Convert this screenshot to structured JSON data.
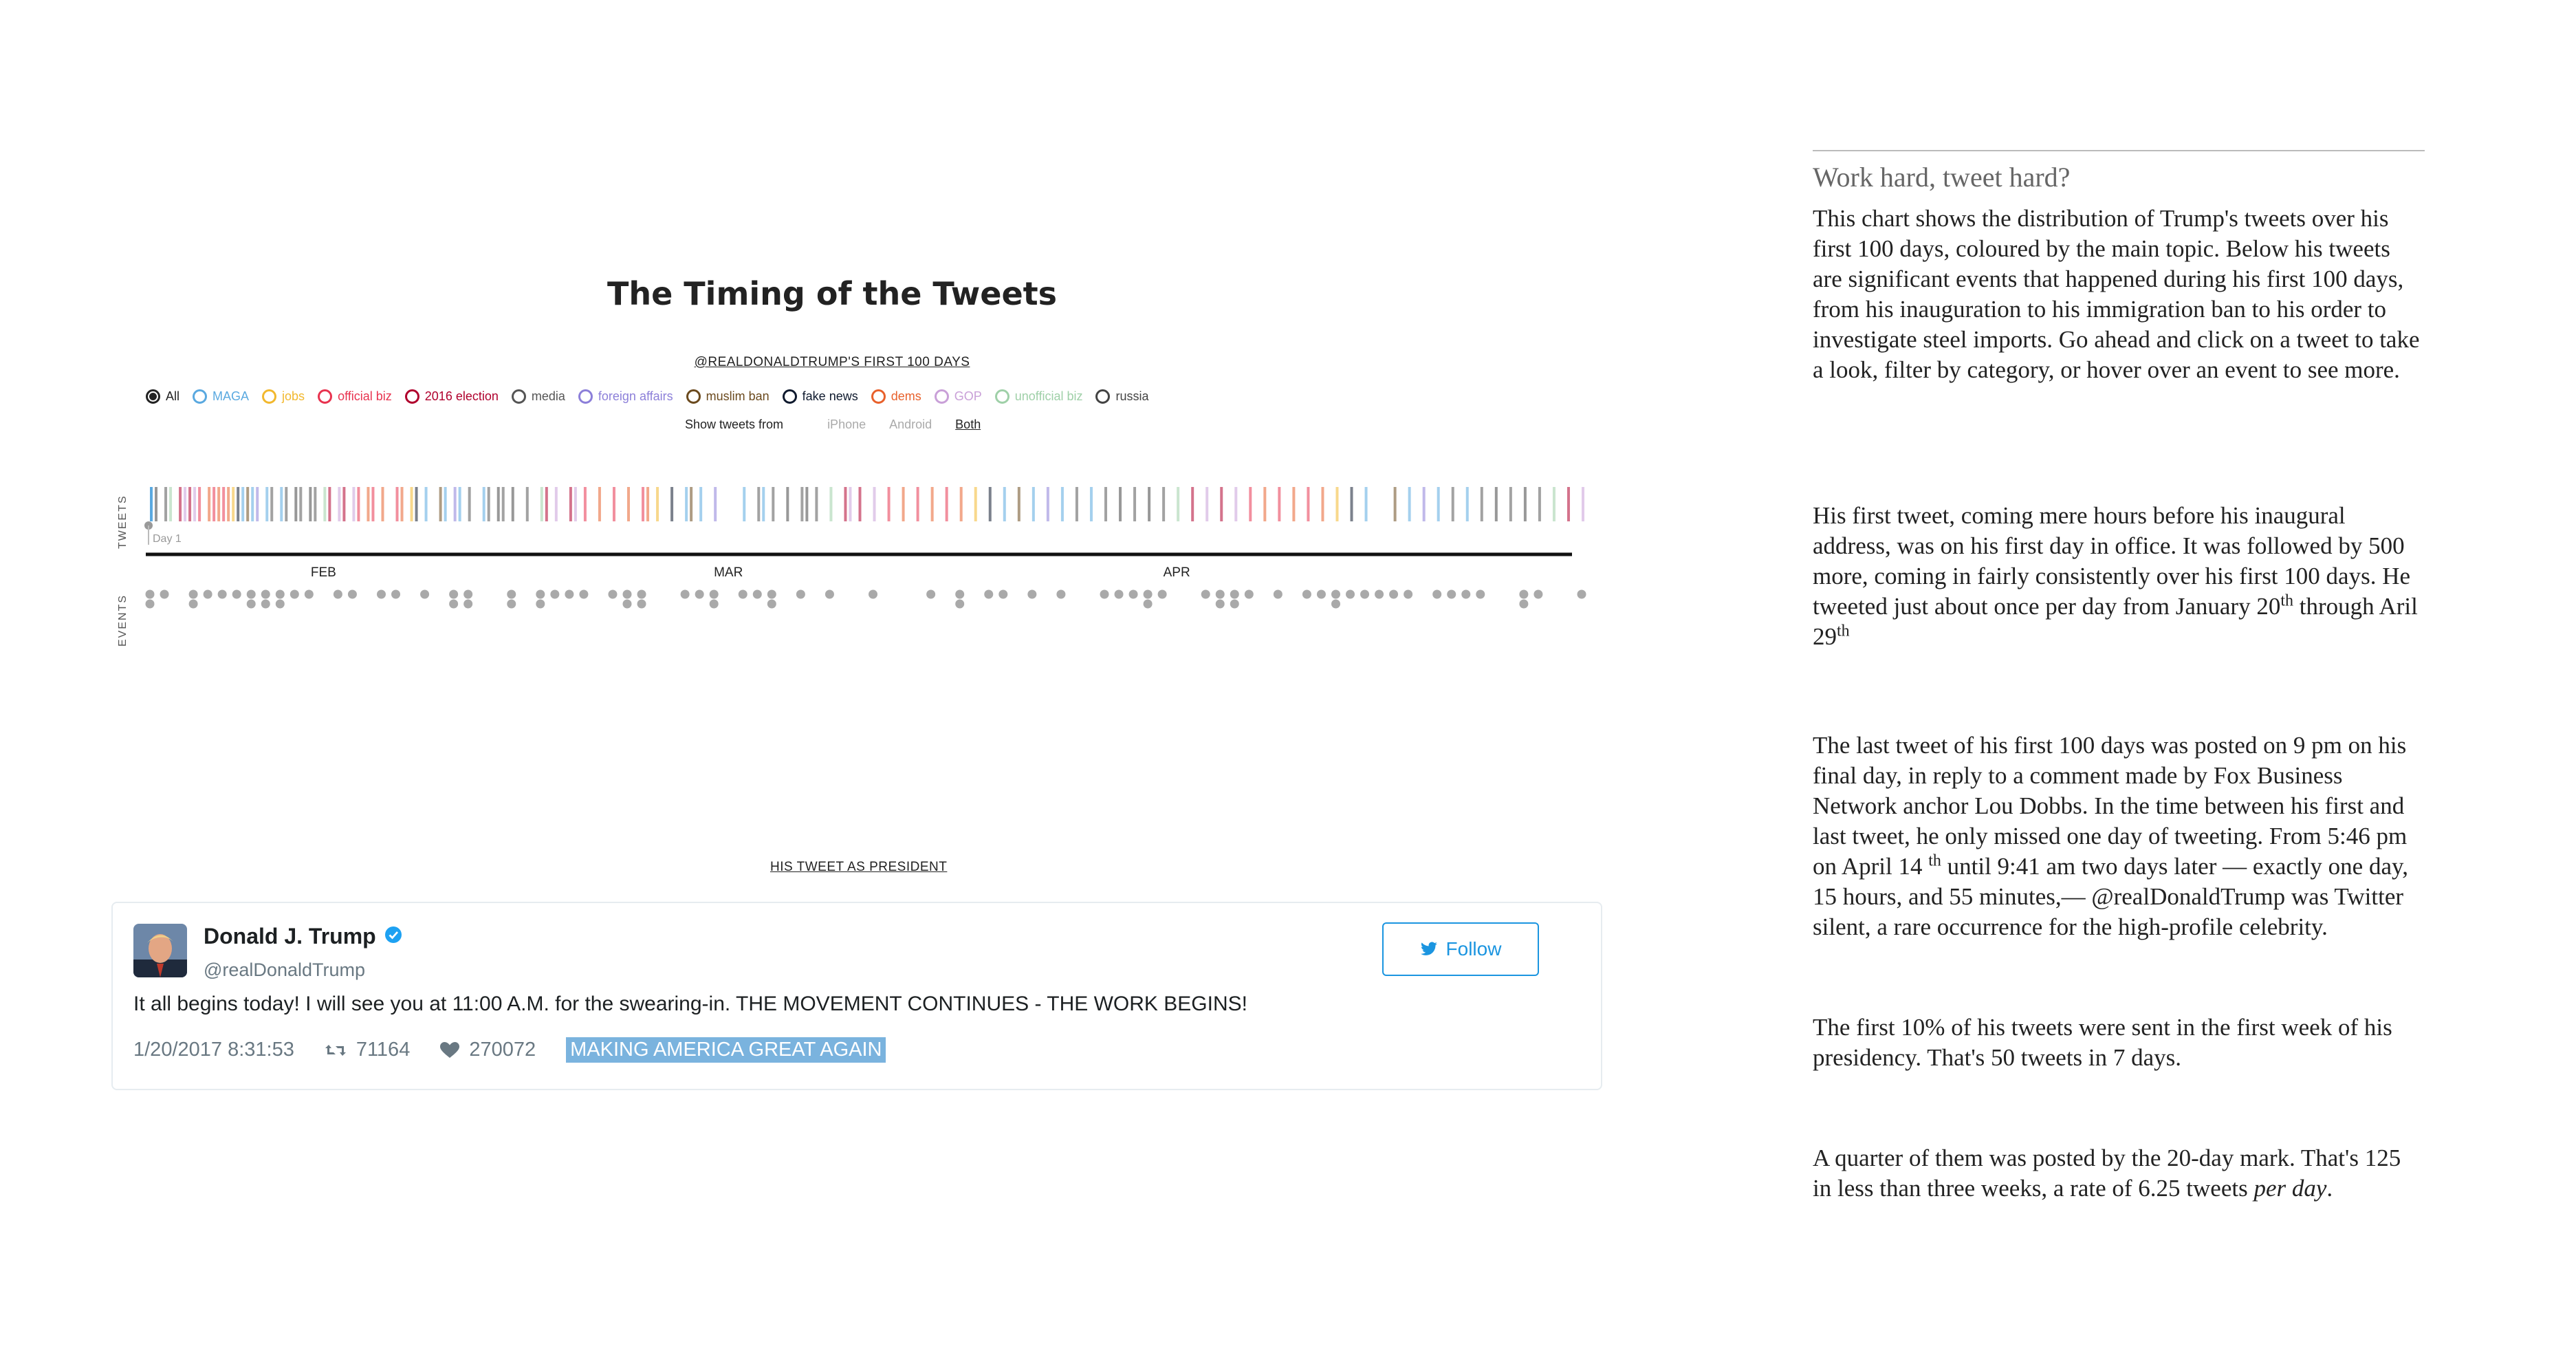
{
  "chart": {
    "title": "The Timing of the Tweets",
    "subtitle": "@REALDONALDTRUMP'S FIRST 100 DAYS",
    "legend": [
      {
        "label": "All",
        "color": "#222222",
        "selected": true
      },
      {
        "label": "MAGA",
        "color": "#5aa9e0"
      },
      {
        "label": "jobs",
        "color": "#f2b82e"
      },
      {
        "label": "official biz",
        "color": "#e8334f"
      },
      {
        "label": "2016 election",
        "color": "#b0002d"
      },
      {
        "label": "media",
        "color": "#555555"
      },
      {
        "label": "foreign affairs",
        "color": "#8c7fd9"
      },
      {
        "label": "muslim ban",
        "color": "#6b4a1e"
      },
      {
        "label": "fake news",
        "color": "#0f1a2e"
      },
      {
        "label": "dems",
        "color": "#e8612c"
      },
      {
        "label": "GOP",
        "color": "#c9a0d8"
      },
      {
        "label": "unofficial biz",
        "color": "#9fd0a8"
      },
      {
        "label": "russia",
        "color": "#444444"
      }
    ],
    "source_filter": {
      "label": "Show tweets from",
      "options": [
        "iPhone",
        "Android",
        "Both"
      ],
      "selected": "Both"
    },
    "axis_tweets": "TWEETS",
    "axis_events": "EVENTS",
    "day_label": "Day 1",
    "months": [
      "FEB",
      "MAR",
      "APR"
    ]
  },
  "chart_data": {
    "type": "timeline",
    "x_range_days": [
      1,
      100
    ],
    "month_ticks": [
      {
        "label": "FEB",
        "day": 13
      },
      {
        "label": "MAR",
        "day": 41
      },
      {
        "label": "APR",
        "day": 72
      }
    ],
    "tweet_days": [
      1,
      1,
      2,
      2,
      3,
      3,
      3,
      4,
      4,
      5,
      5,
      5,
      6,
      6,
      6,
      7,
      7,
      7,
      8,
      8,
      9,
      9,
      10,
      10,
      11,
      11,
      12,
      12,
      13,
      13,
      14,
      14,
      15,
      15,
      16,
      16,
      17,
      18,
      18,
      19,
      19,
      20,
      21,
      21,
      22,
      22,
      23,
      24,
      24,
      25,
      25,
      26,
      27,
      28,
      28,
      29,
      30,
      30,
      31,
      32,
      33,
      34,
      35,
      35,
      36,
      37,
      38,
      38,
      39,
      40,
      42,
      43,
      43,
      44,
      45,
      46,
      46,
      47,
      48,
      49,
      49,
      50,
      51,
      52,
      53,
      54,
      55,
      56,
      57,
      58,
      59,
      60,
      61,
      62,
      63,
      64,
      65,
      66,
      67,
      68,
      69,
      70,
      71,
      72,
      73,
      74,
      75,
      76,
      77,
      78,
      79,
      80,
      81,
      82,
      83,
      84,
      85,
      87,
      88,
      89,
      90,
      91,
      92,
      93,
      94,
      95,
      96,
      97,
      98,
      99,
      100
    ],
    "event_days": [
      1,
      2,
      4,
      5,
      6,
      7,
      8,
      9,
      10,
      11,
      12,
      14,
      15,
      17,
      18,
      20,
      22,
      23,
      26,
      28,
      29,
      30,
      31,
      33,
      34,
      35,
      38,
      39,
      40,
      42,
      43,
      44,
      46,
      48,
      51,
      55,
      57,
      59,
      60,
      62,
      64,
      67,
      68,
      69,
      70,
      71,
      74,
      75,
      76,
      77,
      79,
      81,
      82,
      83,
      84,
      85,
      86,
      87,
      88,
      90,
      91,
      92,
      93,
      96,
      97,
      100
    ],
    "stacked_event_days": [
      1,
      4,
      8,
      9,
      10,
      22,
      23,
      26,
      28,
      34,
      35,
      40,
      44,
      57,
      70,
      75,
      76,
      83,
      96
    ]
  },
  "tweet_panel": {
    "heading": "HIS TWEET AS PRESIDENT",
    "name": "Donald J. Trump",
    "handle": "@realDonaldTrump",
    "follow": "Follow",
    "text": "It all begins today! I will see you at 11:00 A.M. for the swearing-in. THE MOVEMENT CONTINUES - THE WORK BEGINS!",
    "timestamp": "1/20/2017 8:31:53",
    "retweets": "71164",
    "likes": "270072",
    "topic": "MAKING AMERICA GREAT AGAIN",
    "topic_color": "#7ab3de"
  },
  "article": {
    "heading": "Work hard, tweet hard?",
    "p1": "This chart shows the distribution of Trump's tweets over his first 100 days, coloured by the main topic. Below his tweets are significant events that happened during his first 100 days, from his inauguration to his immigration ban to his order to investigate steel imports. Go ahead and click on a tweet to take a look, filter by category, or hover over an event to see more.",
    "p2a": "His first tweet, coming mere hours before his inaugural address, was on his first day in office. It was followed by 500 more, coming in fairly consistently over his first 100 days. He tweeted just about once per day from January 20",
    "p2sup1": "th",
    "p2b": " through Aril 29",
    "p2sup2": "th",
    "p3a": "The last tweet of his first 100 days was posted on 9 pm on his final day, in reply to a comment made by Fox Business Network anchor Lou Dobbs. In the time between his first and last tweet, he only missed one day of tweeting. From 5:46 pm on April 14 ",
    "p3sup": "th",
    "p3b": " until 9:41 am two days later — exactly one day, 15 hours, and 55 minutes,— @realDonaldTrump was Twitter silent, a rare occurrence for the high-profile celebrity.",
    "p4": "The first 10% of his tweets were sent in the first week of his presidency. That's 50 tweets in 7 days.",
    "p5a": "A quarter of them was posted by the 20-day mark. That's 125 in less than three weeks, a rate of 6.25 tweets ",
    "p5em": "per day",
    "p5b": "."
  }
}
